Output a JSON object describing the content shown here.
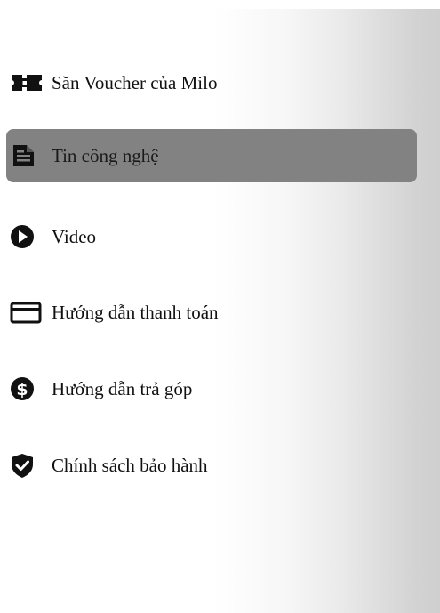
{
  "menu": {
    "items": [
      {
        "label": "Săn Voucher của Milo",
        "icon": "ticket-icon",
        "active": false
      },
      {
        "label": "Tin công nghệ",
        "icon": "article-icon",
        "active": true
      },
      {
        "label": "Video",
        "icon": "play-circle-icon",
        "active": false
      },
      {
        "label": "Hướng dẫn thanh toán",
        "icon": "credit-card-icon",
        "active": false
      },
      {
        "label": "Hướng dẫn trả góp",
        "icon": "dollar-circle-icon",
        "active": false
      },
      {
        "label": "Chính sách bảo hành",
        "icon": "shield-check-icon",
        "active": false
      }
    ]
  },
  "colors": {
    "active_background": "#828282",
    "icon": "#111111",
    "text": "#111111"
  }
}
